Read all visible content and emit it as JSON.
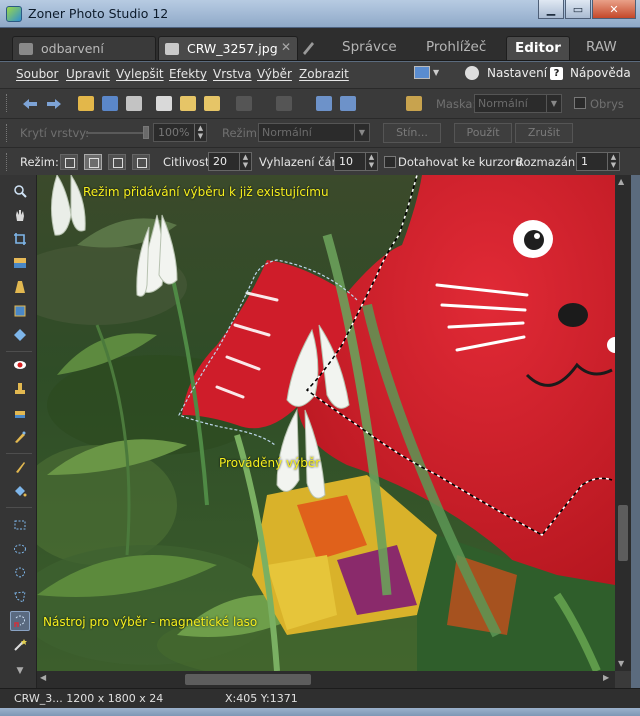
{
  "window": {
    "title": "Zoner Photo Studio 12"
  },
  "tabs": [
    {
      "label": "odbarvení",
      "active": false
    },
    {
      "label": "CRW_3257.jpg",
      "active": true,
      "close": "✕"
    }
  ],
  "modes": [
    {
      "label": "Správce",
      "active": false
    },
    {
      "label": "Prohlížeč",
      "active": false
    },
    {
      "label": "Editor",
      "active": true
    },
    {
      "label": "RAW",
      "active": false
    }
  ],
  "menu": {
    "items": [
      "Soubor",
      "Upravit",
      "Vylepšit",
      "Efekty",
      "Vrstva",
      "Výběr",
      "Zobrazit"
    ],
    "settings": "Nastavení",
    "help": "Nápověda",
    "help_glyph": "?"
  },
  "toolbar1": {
    "mask_label": "Maska:",
    "mask_value": "Normální",
    "outline_label": "Obrys"
  },
  "toolbar2": {
    "opacity_label": "Krytí vrstvy:",
    "opacity_value": "100%",
    "mode_label": "Režim:",
    "mode_value": "Normální",
    "shadow_button": "Stín...",
    "apply_button": "Použít",
    "cancel_button": "Zrušit"
  },
  "toolbar3": {
    "mode_label": "Režim:",
    "sensitivity_label": "Citlivost:",
    "sensitivity_value": "20",
    "smoothing_label": "Vyhlazení čáry:",
    "smoothing_value": "10",
    "cursor_label": "Dotahovat ke kurzoru",
    "blur_label": "Rozmazání:",
    "blur_value": "1"
  },
  "annotations": {
    "mode_add": "Režim přidávání výběru k již existujícímu",
    "in_progress": "Prováděný výběr",
    "tool": "Nástroj pro výběr - magnetické laso"
  },
  "status": {
    "file": "CRW_3... 1200 x 1800 x 24",
    "coords": "X:405  Y:1371"
  },
  "colors": {
    "accent": "#f6ef1e",
    "toy_red": "#d8222f"
  }
}
